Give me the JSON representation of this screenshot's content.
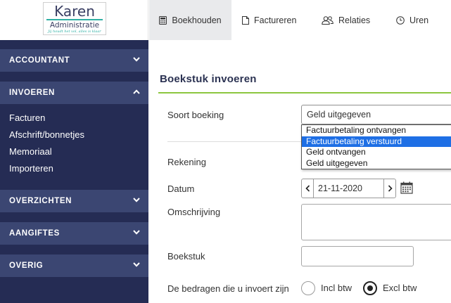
{
  "logo": {
    "name": "Karen",
    "sub": "Administratie",
    "tagline": "Jij houdt het vol, alles is klaar"
  },
  "nav": {
    "tabs": [
      {
        "label": "Boekhouden",
        "icon": "calculator-icon",
        "active": true
      },
      {
        "label": "Factureren",
        "icon": "document-icon",
        "active": false
      },
      {
        "label": "Relaties",
        "icon": "users-icon",
        "active": false
      },
      {
        "label": "Uren",
        "icon": "clock-icon",
        "active": false
      }
    ]
  },
  "sidebar": {
    "sections": [
      {
        "label": "ACCOUNTANT",
        "expanded": false
      },
      {
        "label": "INVOEREN",
        "expanded": true,
        "items": [
          "Facturen",
          "Afschrift/bonnetjes",
          "Memoriaal",
          "Importeren"
        ]
      },
      {
        "label": "OVERZICHTEN",
        "expanded": false
      },
      {
        "label": "AANGIFTES",
        "expanded": false
      },
      {
        "label": "OVERIG",
        "expanded": false
      }
    ]
  },
  "form": {
    "title": "Boekstuk invoeren",
    "soort_label": "Soort boeking",
    "soort_value": "Geld uitgegeven",
    "options": [
      "Factuurbetaling ontvangen",
      "Factuurbetaling verstuurd",
      "Geld ontvangen",
      "Geld uitgegeven"
    ],
    "highlighted_option": "Factuurbetaling verstuurd",
    "rekening_label": "Rekening",
    "datum_label": "Datum",
    "datum_value": "21-11-2020",
    "omschrijving_label": "Omschrijving",
    "boekstuk_label": "Boekstuk",
    "bedragen_label": "De bedragen die u invoert zijn",
    "radio_incl": "Incl btw",
    "radio_excl": "Excl btw",
    "selected_radio": "Excl btw"
  },
  "colors": {
    "sidebar_bg": "#252c54",
    "section_bg": "#3b4672",
    "accent_green": "#8cc63f",
    "highlight_blue": "#1e6fe5",
    "logo_teal": "#2fb0a4"
  }
}
